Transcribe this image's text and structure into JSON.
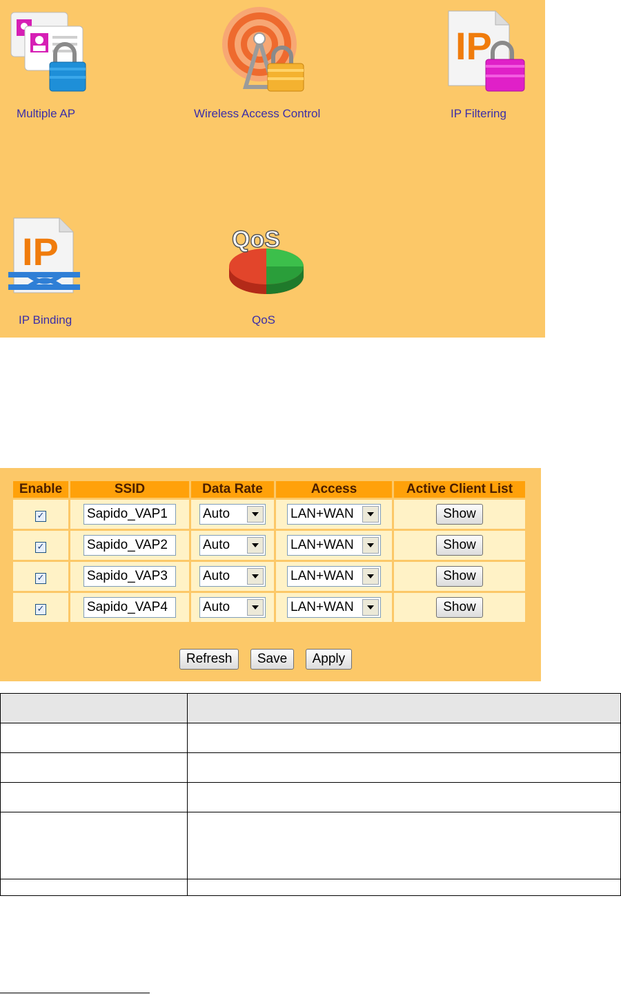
{
  "menu": {
    "items": [
      {
        "label": "Multiple AP"
      },
      {
        "label": "Wireless Access Control"
      },
      {
        "label": "IP Filtering"
      },
      {
        "label": "IP Binding"
      },
      {
        "label": "QoS"
      }
    ],
    "ip_badge": "IP",
    "qos_badge": "QoS"
  },
  "ap_table": {
    "headers": [
      "Enable",
      "SSID",
      "Data Rate",
      "Access",
      "Active Client List"
    ],
    "rows": [
      {
        "enabled": "✓",
        "ssid": "Sapido_VAP1",
        "rate": "Auto",
        "access": "LAN+WAN",
        "action": "Show"
      },
      {
        "enabled": "✓",
        "ssid": "Sapido_VAP2",
        "rate": "Auto",
        "access": "LAN+WAN",
        "action": "Show"
      },
      {
        "enabled": "✓",
        "ssid": "Sapido_VAP3",
        "rate": "Auto",
        "access": "LAN+WAN",
        "action": "Show"
      },
      {
        "enabled": "✓",
        "ssid": "Sapido_VAP4",
        "rate": "Auto",
        "access": "LAN+WAN",
        "action": "Show"
      }
    ],
    "buttons": {
      "refresh": "Refresh",
      "save": "Save",
      "apply": "Apply"
    }
  },
  "colors": {
    "panel_bg": "#fcc868",
    "header_bg": "#ffa10a",
    "cell_bg": "#fff2c6",
    "menu_label": "#3b2ea8"
  },
  "icons": {
    "multiple_ap": "id-cards-lock-icon",
    "wireless_access_control": "antenna-lock-icon",
    "ip_filtering": "ip-document-lock-icon",
    "ip_binding": "ip-document-binding-icon",
    "qos": "qos-pie-icon"
  }
}
